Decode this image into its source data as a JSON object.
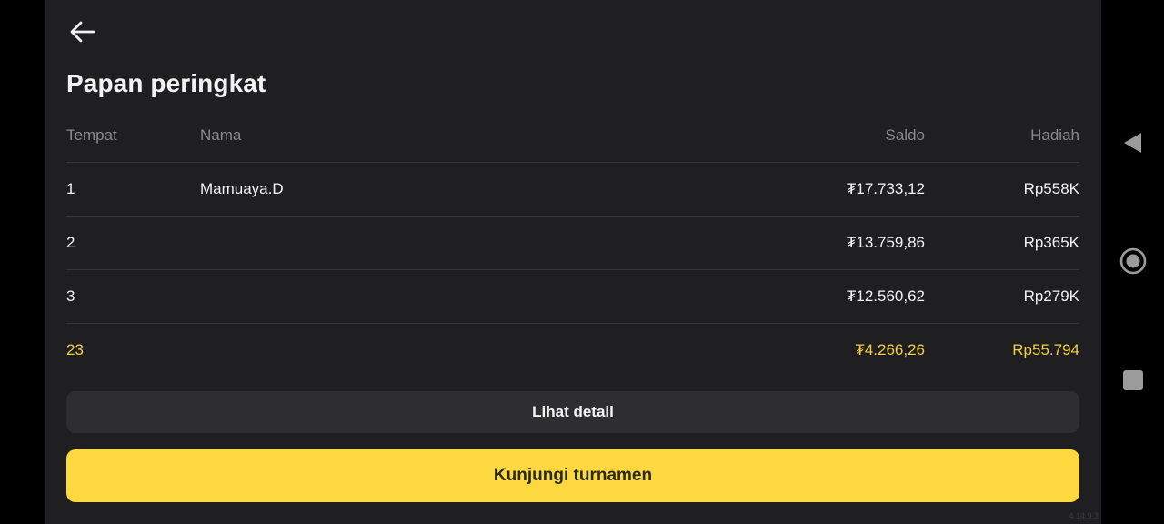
{
  "header": {
    "back_icon": "arrow-left-icon",
    "title": "Papan peringkat"
  },
  "leaderboard": {
    "columns": {
      "place": "Tempat",
      "name": "Nama",
      "balance": "Saldo",
      "prize": "Hadiah"
    },
    "rows": [
      {
        "place": "1",
        "name": "Mamuaya.D",
        "balance": "₮17.733,12",
        "prize": "Rp558K"
      },
      {
        "place": "2",
        "name": "",
        "balance": "₮13.759,86",
        "prize": "Rp365K"
      },
      {
        "place": "3",
        "name": "",
        "balance": "₮12.560,62",
        "prize": "Rp279K"
      }
    ],
    "current_user": {
      "place": "23",
      "balance": "₮4.266,26",
      "prize": "Rp55.794"
    }
  },
  "actions": {
    "detail_label": "Lihat detail",
    "tournament_label": "Kunjungi turnamen"
  },
  "footer": {
    "version": "4.14.9.3"
  },
  "system_nav": {
    "back_icon": "triangle-back-icon",
    "home_icon": "circle-home-icon",
    "recents_icon": "square-recents-icon"
  },
  "colors": {
    "background": "#1f1f21",
    "accent": "#fdd93f",
    "highlight_text": "#f5cf3f",
    "divider": "#363638"
  }
}
